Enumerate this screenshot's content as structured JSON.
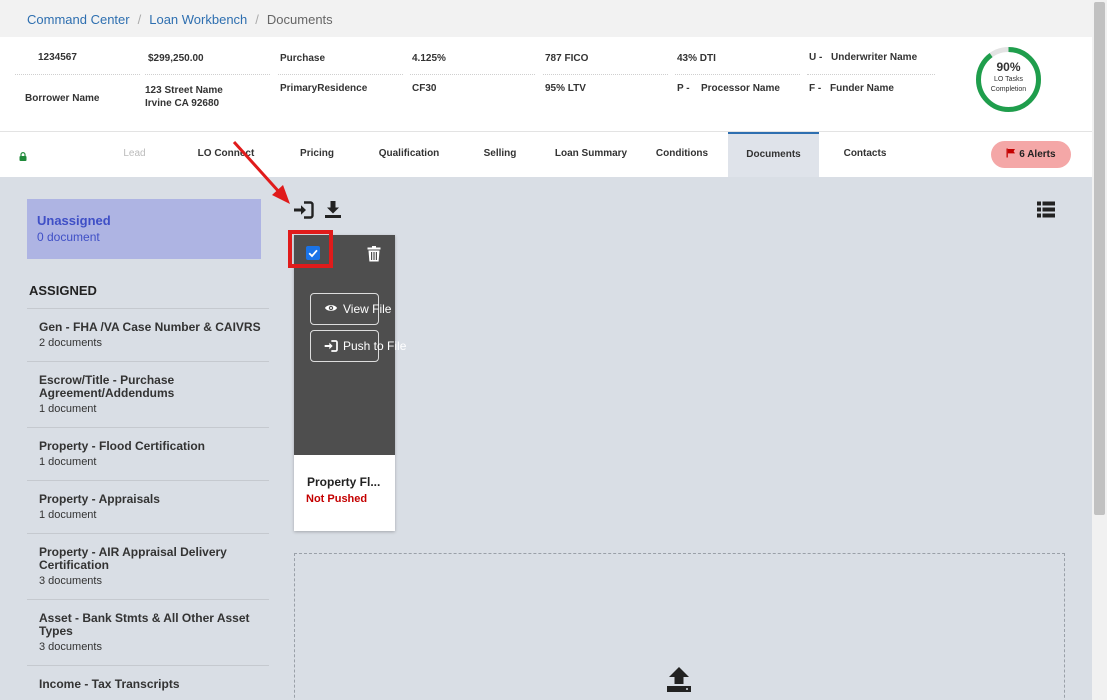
{
  "breadcrumb": {
    "items": [
      "Command Center",
      "Loan Workbench"
    ],
    "current": "Documents"
  },
  "loan": {
    "loan_number": "1234567",
    "amount": "$299,250.00",
    "purpose": "Purchase",
    "rate": "4.125%",
    "fico": "787 FICO",
    "dti": "43% DTI",
    "underwriter_prefix": "U -",
    "underwriter": "Underwriter Name",
    "borrower": "Borrower Name",
    "address_line1": "123 Street Name",
    "address_line2": "Irvine CA 92680",
    "occupancy": "PrimaryResidence",
    "product": "CF30",
    "ltv": "95% LTV",
    "processor_prefix": "P -",
    "processor": "Processor Name",
    "funder_prefix": "F -",
    "funder": "Funder Name"
  },
  "progress": {
    "percent_label": "90%",
    "value": 0.9,
    "label_line1": "LO Tasks",
    "label_line2": "Completion",
    "color": "#1f9e4c"
  },
  "tabs": {
    "lead": "Lead",
    "items": [
      "LO Connect",
      "Pricing",
      "Qualification",
      "Selling",
      "Loan Summary",
      "Conditions",
      "Documents",
      "Contacts"
    ],
    "active": "Documents"
  },
  "alerts": {
    "label": "6 Alerts"
  },
  "sidebar": {
    "unassigned_title": "Unassigned",
    "unassigned_count": "0 document",
    "assigned_heading": "ASSIGNED",
    "items": [
      {
        "title": "Gen - FHA /VA Case Number & CAIVRS",
        "count": "2 documents"
      },
      {
        "title": "Escrow/Title - Purchase Agreement/Addendums",
        "count": "1 document"
      },
      {
        "title": "Property - Flood Certification",
        "count": "1 document"
      },
      {
        "title": "Property - Appraisals",
        "count": "1 document"
      },
      {
        "title": "Property - AIR Appraisal Delivery Certification",
        "count": "3 documents"
      },
      {
        "title": "Asset - Bank Stmts & All Other Asset Types",
        "count": "3 documents"
      },
      {
        "title": "Income - Tax Transcripts",
        "count": ""
      }
    ]
  },
  "card": {
    "view_label": "View File",
    "push_label": "Push to File",
    "name": "Property Fl...",
    "status": "Not Pushed",
    "checked": true
  },
  "colors": {
    "accent": "#2e6fb0",
    "alert_bg": "#f4a7a7",
    "status_red": "#c40000",
    "annotation_red": "#e01b1b"
  }
}
